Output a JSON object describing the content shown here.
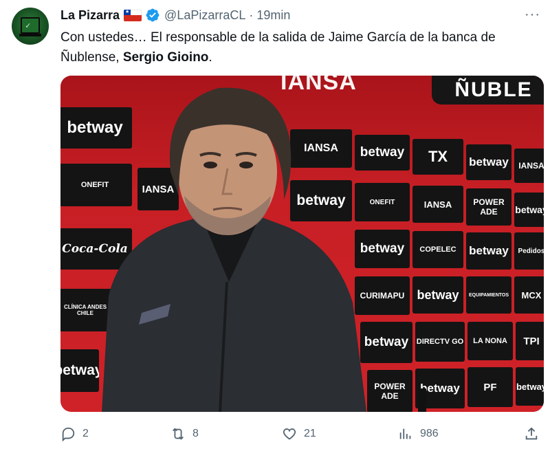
{
  "tweet": {
    "author_name": "La Pizarra",
    "handle": "@LaPizarraCL",
    "separator": "·",
    "time": "19min",
    "more_label": "···",
    "text_line1": "Con ustedes… El responsable de la salida de Jaime García de la banca de",
    "text_line2_prefix": "Ñublense, ",
    "text_bold": "Sergio Gioino",
    "text_suffix": "."
  },
  "photo": {
    "banner_left": "IANSA",
    "banner_right": "ÑUBLE",
    "sponsors": {
      "betway": "betway",
      "iansa": "IANSA",
      "onefit": "ONEFIT",
      "cocacola": "Coca-Cola",
      "tx": "TX",
      "powerade": "POWER ADE",
      "copelec": "COPELEC",
      "curimapu": "CURIMAPU",
      "equipamientos": "EQUIPAMIENTOS",
      "directv": "DIRECTV GO",
      "lanona": "LA NONA",
      "pf": "PF",
      "clinica": "CLÍNICA ANDES CHILE",
      "pedidos": "Pedidos",
      "mcx": "MCX",
      "tpi": "TPI"
    }
  },
  "actions": {
    "replies": "2",
    "reposts": "8",
    "likes": "21",
    "views": "986"
  },
  "colors": {
    "text": "#0f1419",
    "muted": "#536471",
    "verified": "#1d9bf0",
    "backdrop_red": "#c71f25",
    "sponsor_black": "#141414"
  },
  "icons": [
    "verified-badge-icon",
    "chile-flag-icon",
    "more-icon",
    "reply-icon",
    "repost-icon",
    "like-icon",
    "views-icon",
    "share-icon"
  ]
}
